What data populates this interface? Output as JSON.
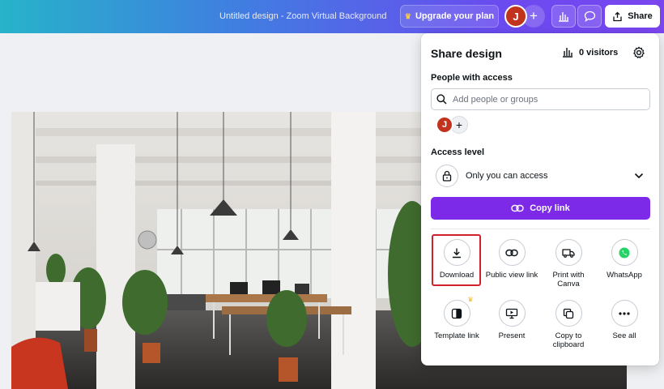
{
  "topbar": {
    "doc_title": "Untitled design - Zoom Virtual Background",
    "upgrade_label": "Upgrade your plan",
    "avatar_initial": "J",
    "share_label": "Share"
  },
  "panel": {
    "title": "Share design",
    "visitors": "0 visitors",
    "people_label": "People with access",
    "search_placeholder": "Add people or groups",
    "mini_avatar_initial": "J",
    "access_label": "Access level",
    "access_value": "Only you can access",
    "copy_link_label": "Copy link",
    "actions": [
      {
        "label": "Download",
        "icon": "download-icon"
      },
      {
        "label": "Public view link",
        "icon": "link-icon"
      },
      {
        "label": "Print with Canva",
        "icon": "truck-icon"
      },
      {
        "label": "WhatsApp",
        "icon": "whatsapp-icon"
      },
      {
        "label": "Template link",
        "icon": "template-icon"
      },
      {
        "label": "Present",
        "icon": "present-icon"
      },
      {
        "label": "Copy to clipboard",
        "icon": "copy-icon"
      },
      {
        "label": "See all",
        "icon": "more-icon"
      }
    ]
  },
  "colors": {
    "accent": "#7d2ae8",
    "highlight": "#d0222d",
    "avatar": "#c2331e",
    "whatsapp": "#25d366"
  }
}
